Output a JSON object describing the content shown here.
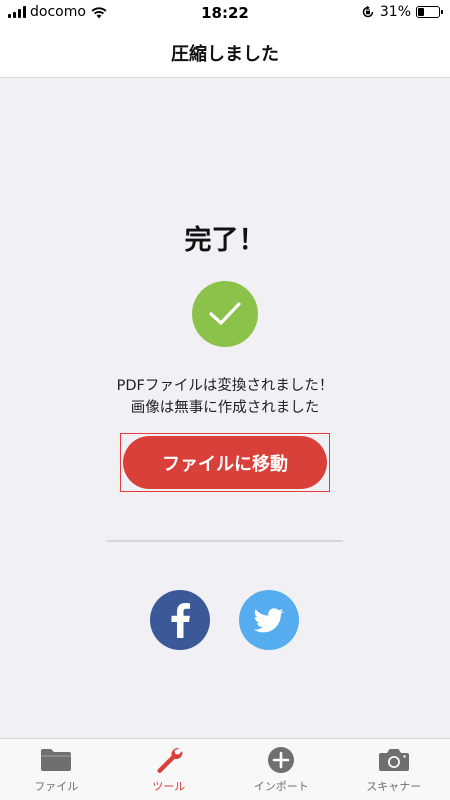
{
  "status_bar": {
    "carrier": "docomo",
    "time": "18:22",
    "battery_percent": "31%",
    "battery_level": 0.31
  },
  "nav": {
    "title": "圧縮しました"
  },
  "result": {
    "heading": "完了！",
    "message_line1": "PDFファイルは変換されました！",
    "message_line2": "画像は無事に作成されました",
    "move_button_label": "ファイルに移動"
  },
  "share": {
    "facebook_icon": "facebook-icon",
    "twitter_icon": "twitter-icon"
  },
  "tab_bar": {
    "tabs": [
      {
        "label": "ファイル",
        "icon": "folder-icon",
        "active": false
      },
      {
        "label": "ツール",
        "icon": "wrench-icon",
        "active": true
      },
      {
        "label": "インポート",
        "icon": "plus-circle-icon",
        "active": false
      },
      {
        "label": "スキャナー",
        "icon": "camera-icon",
        "active": false
      }
    ]
  },
  "colors": {
    "accent": "#d9403a",
    "success": "#8bc34a",
    "facebook": "#3b5998",
    "twitter": "#55acee",
    "inactive_tab": "#6f6f6f"
  }
}
